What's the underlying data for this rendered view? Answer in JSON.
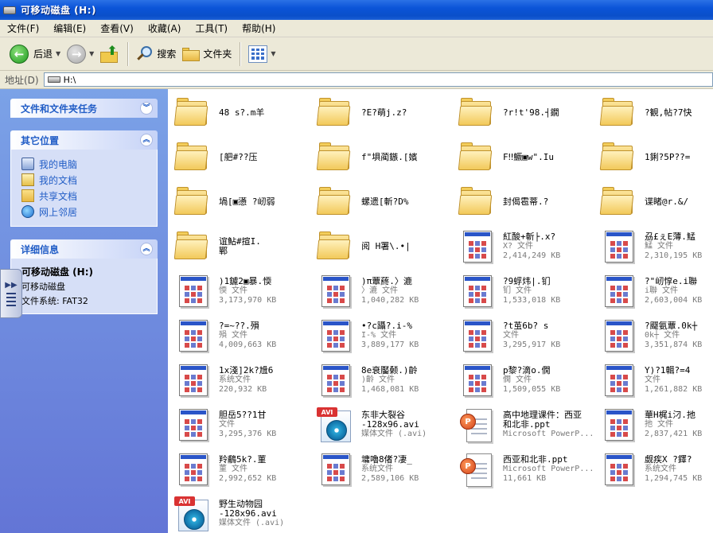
{
  "window": {
    "title": "可移动磁盘 (H:)"
  },
  "menu": [
    "文件(F)",
    "编辑(E)",
    "查看(V)",
    "收藏(A)",
    "工具(T)",
    "帮助(H)"
  ],
  "toolbar": {
    "back_label": "后退",
    "search_label": "搜索",
    "folders_label": "文件夹"
  },
  "address": {
    "label": "地址(D)",
    "value": "H:\\"
  },
  "sidebar": {
    "tasks_title": "文件和文件夹任务",
    "places_title": "其它位置",
    "places": [
      "我的电脑",
      "我的文档",
      "共享文档",
      "网上邻居"
    ],
    "details_title": "详细信息",
    "details": {
      "name": "可移动磁盘 (H:)",
      "type": "可移动磁盘",
      "fs": "文件系统: FAT32"
    }
  },
  "files": [
    {
      "icon": "folder",
      "name": "48 s?.m羊",
      "type": "",
      "size": ""
    },
    {
      "icon": "folder",
      "name": "?E?萌j.z?",
      "type": "",
      "size": ""
    },
    {
      "icon": "folder",
      "name": "?r!t'98.┤鐗",
      "type": "",
      "size": ""
    },
    {
      "icon": "folder",
      "name": "?観,帖?7快",
      "type": "",
      "size": ""
    },
    {
      "icon": "folder",
      "name": "[舥#??压",
      "type": "",
      "size": ""
    },
    {
      "icon": "folder",
      "name": "f\"埧蔺鏃.[嬪",
      "type": "",
      "size": ""
    },
    {
      "icon": "folder",
      "name": "F‼鱖▣w\".Iu",
      "type": "",
      "size": ""
    },
    {
      "icon": "folder",
      "name": "1鋓?5P??=",
      "type": "",
      "size": ""
    },
    {
      "icon": "folder",
      "name": "堝[▣懣 ?屻弱",
      "type": "",
      "size": ""
    },
    {
      "icon": "folder",
      "name": "螺遗[斬?D%",
      "type": "",
      "size": ""
    },
    {
      "icon": "folder",
      "name": "封偈雹蒂.?",
      "type": "",
      "size": ""
    },
    {
      "icon": "folder",
      "name": "谍睹@r.&/",
      "type": "",
      "size": ""
    },
    {
      "icon": "folder",
      "name": "谊鮎#揎I.\n鄲",
      "type": "",
      "size": ""
    },
    {
      "icon": "folder",
      "name": "阅 H署\\.•|",
      "type": "",
      "size": ""
    },
    {
      "icon": "app",
      "name": "紅酸+斬├.x?",
      "type": "X? 文件",
      "size": "2,414,249 KB"
    },
    {
      "icon": "app",
      "name": "刕£ぇE薄.鯭",
      "type": "鯭 文件",
      "size": "2,310,195 KB"
    },
    {
      "icon": "app",
      "name": ")1鑢2▣暴.愞",
      "type": "愞 文件",
      "size": "3,173,970 KB"
    },
    {
      "icon": "app",
      "name": ")π蕈蔠.〉漉",
      "type": "〉漉 文件",
      "size": "1,040,282 KB"
    },
    {
      "icon": "app",
      "name": "?9蜉炜|.钔",
      "type": "钔 文件",
      "size": "1,533,018 KB"
    },
    {
      "icon": "app",
      "name": "?\"屻惇e.i聯",
      "type": "i聯 文件",
      "size": "2,603,004 KB"
    },
    {
      "icon": "app",
      "name": "?=~??.殞",
      "type": "殞 文件",
      "size": "4,009,663 KB"
    },
    {
      "icon": "app",
      "name": "•?c躡?.i-%",
      "type": "I-% 文件",
      "size": "3,889,177 KB"
    },
    {
      "icon": "app",
      "name": "?t茧6b? s",
      "type": "文件",
      "size": "3,295,917 KB"
    },
    {
      "icon": "app",
      "name": "?飋氨蕈.0k┼",
      "type": "0k┼ 文件",
      "size": "3,351,874 KB"
    },
    {
      "icon": "app",
      "name": "1x淺]2k?尳6",
      "type": "系统文件",
      "size": "220,932 KB"
    },
    {
      "icon": "app",
      "name": "8e衰靨颡.)齡",
      "type": ")齡 文件",
      "size": "1,468,081 KB"
    },
    {
      "icon": "app",
      "name": "p黎?滴o.僩",
      "type": "僩 文件",
      "size": "1,509,055 KB"
    },
    {
      "icon": "app",
      "name": "Y)?1輯?=4",
      "type": "文件",
      "size": "1,261,882 KB"
    },
    {
      "icon": "app",
      "name": "胆岳5??1甘",
      "type": "文件",
      "size": "3,295,376 KB"
    },
    {
      "icon": "avi",
      "name": "东非大裂谷\n-128x96.avi",
      "type": "媒体文件 (.avi)",
      "size": ""
    },
    {
      "icon": "ppt",
      "name": "高中地理课件：西亚\n和北非.ppt",
      "type": "Microsoft PowerP...",
      "size": ""
    },
    {
      "icon": "app",
      "name": "華H梶i汈.扡",
      "type": "扡 文件",
      "size": "2,837,421 KB"
    },
    {
      "icon": "app",
      "name": "羚鵏5k?.菫",
      "type": "菫 文件",
      "size": "2,992,652 KB"
    },
    {
      "icon": "app",
      "name": "墉嚕8偖?凄_",
      "type": "系统文件",
      "size": "2,589,106 KB"
    },
    {
      "icon": "ppt",
      "name": "西亚和北非.ppt",
      "type": "Microsoft PowerP...",
      "size": "11,661 KB"
    },
    {
      "icon": "app",
      "name": "觑疾X ?鐸?",
      "type": "系统文件",
      "size": "1,294,745 KB"
    },
    {
      "icon": "avi",
      "name": "野生动物园\n-128x96.avi",
      "type": "媒体文件 (.avi)",
      "size": ""
    }
  ],
  "colors": {
    "title_bar": "#0b54d8",
    "sidebar": "#7ba2e7",
    "panel_header_text": "#215dc6"
  }
}
